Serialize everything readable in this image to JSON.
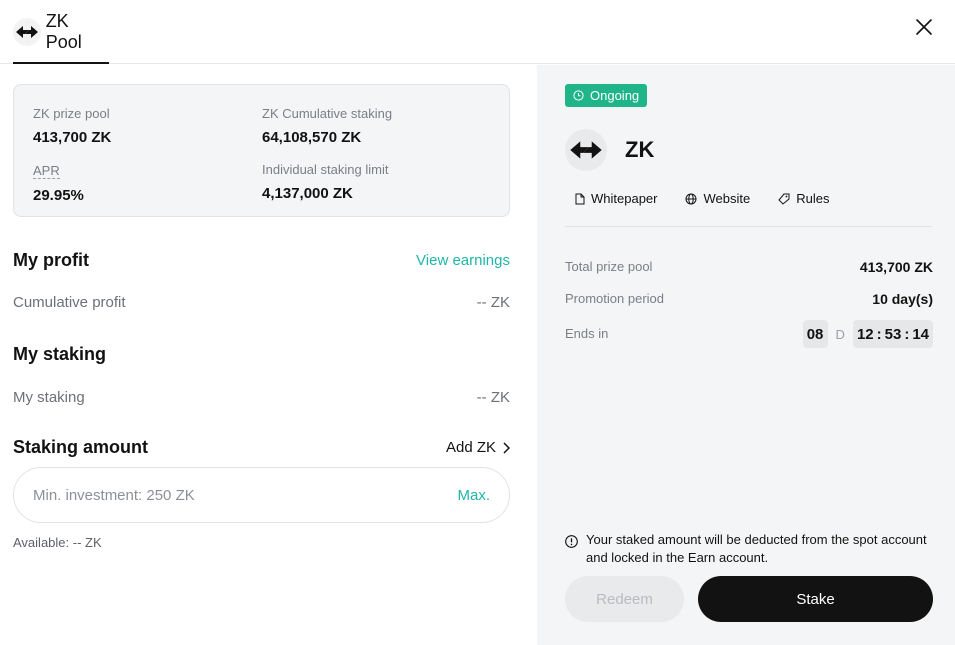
{
  "header": {
    "tab_title": "ZK Pool",
    "logo_icon": "zk-arrows-icon",
    "close_icon": "close-icon"
  },
  "stats": {
    "prize_pool_label": "ZK prize pool",
    "prize_pool_value": "413,700 ZK",
    "cumulative_label": "ZK Cumulative staking",
    "cumulative_value": "64,108,570 ZK",
    "apr_label": "APR",
    "apr_value": "29.95%",
    "limit_label": "Individual staking limit",
    "limit_value": "4,137,000 ZK"
  },
  "profit": {
    "title": "My profit",
    "view_earnings": "View earnings",
    "cumulative_label": "Cumulative profit",
    "cumulative_value": "-- ZK"
  },
  "staking": {
    "title": "My staking",
    "label": "My staking",
    "value": "-- ZK"
  },
  "amount": {
    "title": "Staking amount",
    "add_label": "Add ZK",
    "placeholder": "Min. investment: 250 ZK",
    "max_label": "Max.",
    "available": "Available: -- ZK"
  },
  "detail": {
    "status_badge": "Ongoing",
    "coin_name": "ZK",
    "links": {
      "whitepaper": "Whitepaper",
      "website": "Website",
      "rules": "Rules"
    },
    "total_pool_label": "Total prize pool",
    "total_pool_value": "413,700 ZK",
    "period_label": "Promotion period",
    "period_value": "10 day(s)",
    "ends_label": "Ends in",
    "countdown": {
      "days": "08",
      "day_unit": "D",
      "hours": "12",
      "minutes": "53",
      "seconds": "14",
      "colon": ":"
    },
    "notice": "Your staked amount will be deducted from the spot account and locked in the Earn account.",
    "redeem_label": "Redeem",
    "stake_label": "Stake"
  },
  "colors": {
    "accent_teal": "#1fb6a8",
    "badge_green": "#1fb589",
    "primary_dark": "#121212",
    "panel_bg": "#f4f5f6"
  }
}
